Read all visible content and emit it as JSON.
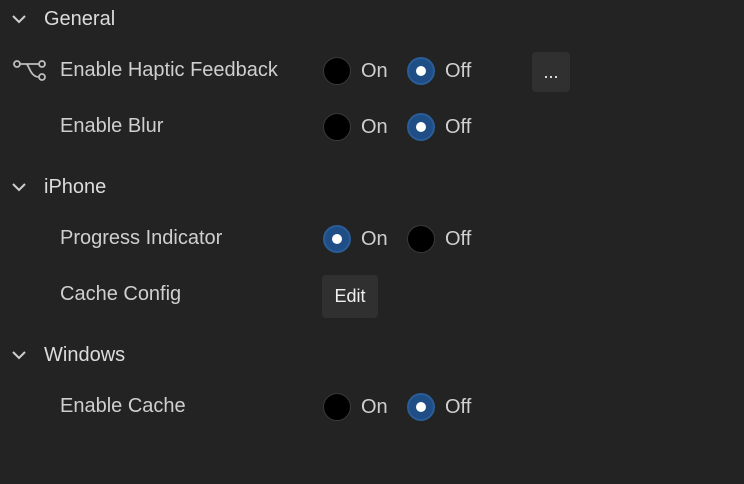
{
  "sections": [
    {
      "title": "General",
      "rows": [
        {
          "label": "Enable Haptic Feedback",
          "options": [
            "On",
            "Off"
          ],
          "selected": "Off",
          "action_button": "..."
        },
        {
          "label": "Enable Blur",
          "options": [
            "On",
            "Off"
          ],
          "selected": "Off"
        }
      ]
    },
    {
      "title": "iPhone",
      "rows": [
        {
          "label": "Progress Indicator",
          "options": [
            "On",
            "Off"
          ],
          "selected": "On"
        },
        {
          "label": "Cache Config",
          "button": "Edit"
        }
      ]
    },
    {
      "title": "Windows",
      "rows": [
        {
          "label": "Enable Cache",
          "options": [
            "On",
            "Off"
          ],
          "selected": "Off"
        }
      ]
    }
  ],
  "icons": {
    "section_toggle": "chevron-down-icon",
    "row_icon": "git-branch-icon"
  },
  "colors": {
    "background": "#232323",
    "radio_selected": "#1f4e86",
    "radio_unselected": "#000000",
    "button_bg": "#303030"
  }
}
